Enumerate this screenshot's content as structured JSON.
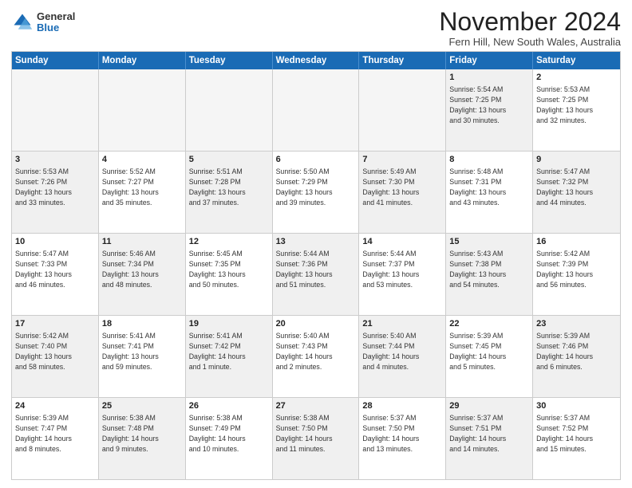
{
  "header": {
    "logo_general": "General",
    "logo_blue": "Blue",
    "month_title": "November 2024",
    "location": "Fern Hill, New South Wales, Australia"
  },
  "calendar": {
    "days_of_week": [
      "Sunday",
      "Monday",
      "Tuesday",
      "Wednesday",
      "Thursday",
      "Friday",
      "Saturday"
    ],
    "rows": [
      [
        {
          "day": "",
          "empty": true
        },
        {
          "day": "",
          "empty": true
        },
        {
          "day": "",
          "empty": true
        },
        {
          "day": "",
          "empty": true
        },
        {
          "day": "",
          "empty": true
        },
        {
          "day": "1",
          "lines": [
            "Sunrise: 5:54 AM",
            "Sunset: 7:25 PM",
            "Daylight: 13 hours",
            "and 30 minutes."
          ],
          "shaded": true
        },
        {
          "day": "2",
          "lines": [
            "Sunrise: 5:53 AM",
            "Sunset: 7:25 PM",
            "Daylight: 13 hours",
            "and 32 minutes."
          ],
          "shaded": false
        }
      ],
      [
        {
          "day": "3",
          "lines": [
            "Sunrise: 5:53 AM",
            "Sunset: 7:26 PM",
            "Daylight: 13 hours",
            "and 33 minutes."
          ],
          "shaded": true
        },
        {
          "day": "4",
          "lines": [
            "Sunrise: 5:52 AM",
            "Sunset: 7:27 PM",
            "Daylight: 13 hours",
            "and 35 minutes."
          ],
          "shaded": false
        },
        {
          "day": "5",
          "lines": [
            "Sunrise: 5:51 AM",
            "Sunset: 7:28 PM",
            "Daylight: 13 hours",
            "and 37 minutes."
          ],
          "shaded": true
        },
        {
          "day": "6",
          "lines": [
            "Sunrise: 5:50 AM",
            "Sunset: 7:29 PM",
            "Daylight: 13 hours",
            "and 39 minutes."
          ],
          "shaded": false
        },
        {
          "day": "7",
          "lines": [
            "Sunrise: 5:49 AM",
            "Sunset: 7:30 PM",
            "Daylight: 13 hours",
            "and 41 minutes."
          ],
          "shaded": true
        },
        {
          "day": "8",
          "lines": [
            "Sunrise: 5:48 AM",
            "Sunset: 7:31 PM",
            "Daylight: 13 hours",
            "and 43 minutes."
          ],
          "shaded": false
        },
        {
          "day": "9",
          "lines": [
            "Sunrise: 5:47 AM",
            "Sunset: 7:32 PM",
            "Daylight: 13 hours",
            "and 44 minutes."
          ],
          "shaded": true
        }
      ],
      [
        {
          "day": "10",
          "lines": [
            "Sunrise: 5:47 AM",
            "Sunset: 7:33 PM",
            "Daylight: 13 hours",
            "and 46 minutes."
          ],
          "shaded": false
        },
        {
          "day": "11",
          "lines": [
            "Sunrise: 5:46 AM",
            "Sunset: 7:34 PM",
            "Daylight: 13 hours",
            "and 48 minutes."
          ],
          "shaded": true
        },
        {
          "day": "12",
          "lines": [
            "Sunrise: 5:45 AM",
            "Sunset: 7:35 PM",
            "Daylight: 13 hours",
            "and 50 minutes."
          ],
          "shaded": false
        },
        {
          "day": "13",
          "lines": [
            "Sunrise: 5:44 AM",
            "Sunset: 7:36 PM",
            "Daylight: 13 hours",
            "and 51 minutes."
          ],
          "shaded": true
        },
        {
          "day": "14",
          "lines": [
            "Sunrise: 5:44 AM",
            "Sunset: 7:37 PM",
            "Daylight: 13 hours",
            "and 53 minutes."
          ],
          "shaded": false
        },
        {
          "day": "15",
          "lines": [
            "Sunrise: 5:43 AM",
            "Sunset: 7:38 PM",
            "Daylight: 13 hours",
            "and 54 minutes."
          ],
          "shaded": true
        },
        {
          "day": "16",
          "lines": [
            "Sunrise: 5:42 AM",
            "Sunset: 7:39 PM",
            "Daylight: 13 hours",
            "and 56 minutes."
          ],
          "shaded": false
        }
      ],
      [
        {
          "day": "17",
          "lines": [
            "Sunrise: 5:42 AM",
            "Sunset: 7:40 PM",
            "Daylight: 13 hours",
            "and 58 minutes."
          ],
          "shaded": true
        },
        {
          "day": "18",
          "lines": [
            "Sunrise: 5:41 AM",
            "Sunset: 7:41 PM",
            "Daylight: 13 hours",
            "and 59 minutes."
          ],
          "shaded": false
        },
        {
          "day": "19",
          "lines": [
            "Sunrise: 5:41 AM",
            "Sunset: 7:42 PM",
            "Daylight: 14 hours",
            "and 1 minute."
          ],
          "shaded": true
        },
        {
          "day": "20",
          "lines": [
            "Sunrise: 5:40 AM",
            "Sunset: 7:43 PM",
            "Daylight: 14 hours",
            "and 2 minutes."
          ],
          "shaded": false
        },
        {
          "day": "21",
          "lines": [
            "Sunrise: 5:40 AM",
            "Sunset: 7:44 PM",
            "Daylight: 14 hours",
            "and 4 minutes."
          ],
          "shaded": true
        },
        {
          "day": "22",
          "lines": [
            "Sunrise: 5:39 AM",
            "Sunset: 7:45 PM",
            "Daylight: 14 hours",
            "and 5 minutes."
          ],
          "shaded": false
        },
        {
          "day": "23",
          "lines": [
            "Sunrise: 5:39 AM",
            "Sunset: 7:46 PM",
            "Daylight: 14 hours",
            "and 6 minutes."
          ],
          "shaded": true
        }
      ],
      [
        {
          "day": "24",
          "lines": [
            "Sunrise: 5:39 AM",
            "Sunset: 7:47 PM",
            "Daylight: 14 hours",
            "and 8 minutes."
          ],
          "shaded": false
        },
        {
          "day": "25",
          "lines": [
            "Sunrise: 5:38 AM",
            "Sunset: 7:48 PM",
            "Daylight: 14 hours",
            "and 9 minutes."
          ],
          "shaded": true
        },
        {
          "day": "26",
          "lines": [
            "Sunrise: 5:38 AM",
            "Sunset: 7:49 PM",
            "Daylight: 14 hours",
            "and 10 minutes."
          ],
          "shaded": false
        },
        {
          "day": "27",
          "lines": [
            "Sunrise: 5:38 AM",
            "Sunset: 7:50 PM",
            "Daylight: 14 hours",
            "and 11 minutes."
          ],
          "shaded": true
        },
        {
          "day": "28",
          "lines": [
            "Sunrise: 5:37 AM",
            "Sunset: 7:50 PM",
            "Daylight: 14 hours",
            "and 13 minutes."
          ],
          "shaded": false
        },
        {
          "day": "29",
          "lines": [
            "Sunrise: 5:37 AM",
            "Sunset: 7:51 PM",
            "Daylight: 14 hours",
            "and 14 minutes."
          ],
          "shaded": true
        },
        {
          "day": "30",
          "lines": [
            "Sunrise: 5:37 AM",
            "Sunset: 7:52 PM",
            "Daylight: 14 hours",
            "and 15 minutes."
          ],
          "shaded": false
        }
      ]
    ]
  }
}
